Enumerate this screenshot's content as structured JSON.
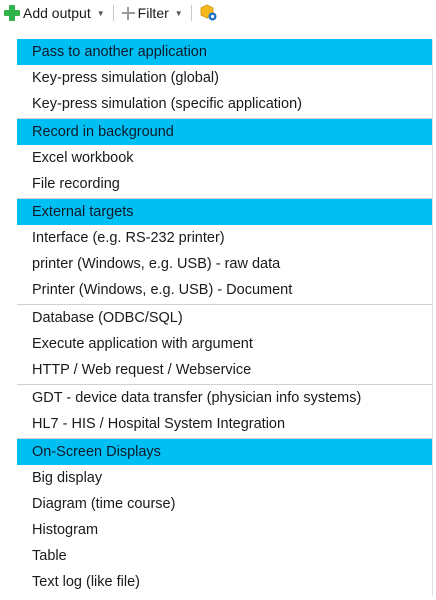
{
  "toolbar": {
    "add_output_label": "Add output",
    "filter_label": "Filter",
    "add_icon": "plus-green-icon",
    "filter_icon": "plus-gray-icon",
    "extra_icon": "hexagon-settings-icon"
  },
  "colors": {
    "header_bg": "#00bff3",
    "add_icon_green": "#2fb34a",
    "separator": "#d2d2d2"
  },
  "menu": {
    "groups": [
      {
        "header": "Pass to another application",
        "items": [
          "Key-press simulation (global)",
          "Key-press simulation (specific application)"
        ]
      },
      {
        "header": "Record in background",
        "items": [
          "Excel workbook",
          "File recording"
        ]
      },
      {
        "header": "External targets",
        "items": [
          "Interface (e.g. RS-232 printer)",
          "printer (Windows, e.g. USB) - raw data",
          "Printer (Windows, e.g. USB) - Document"
        ]
      },
      {
        "header": "",
        "items": [
          "Database (ODBC/SQL)",
          "Execute application with argument",
          "HTTP / Web request / Webservice"
        ]
      },
      {
        "header": "",
        "items": [
          "GDT - device data transfer (physician info systems)",
          "HL7 - HIS / Hospital System Integration"
        ]
      },
      {
        "header": "On-Screen Displays",
        "items": [
          "Big display",
          "Diagram (time course)",
          "Histogram",
          "Table",
          "Text log (like file)"
        ]
      }
    ]
  }
}
